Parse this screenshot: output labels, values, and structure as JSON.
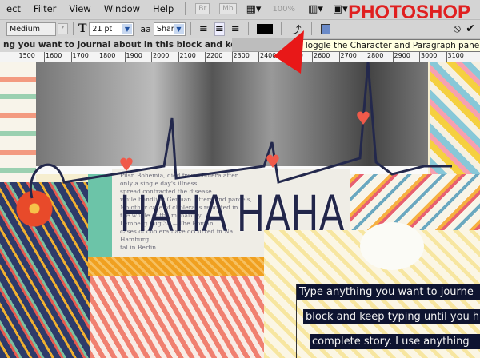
{
  "menu": [
    "ect",
    "Filter",
    "View",
    "Window",
    "Help"
  ],
  "menu_mini": [
    "Br",
    "Mb"
  ],
  "zoom_level": "100%",
  "brand": "PHOTOSHOP",
  "options": {
    "antialias_weight": "Medium",
    "font_size": "21 pt",
    "aa_label": "a",
    "aa_sub": "a",
    "antialias": "Sharp"
  },
  "document_tab": "ng you want to journal about in this block and keep , RGB/8) *",
  "tooltip": "Toggle the Character and Paragraph panels",
  "ruler": [
    "00",
    "1500",
    "1600",
    "1700",
    "1800",
    "1900",
    "2000",
    "2100",
    "2200",
    "2300",
    "2400",
    "2500",
    "2600",
    "2700",
    "2800",
    "2900",
    "3000",
    "3100"
  ],
  "canvas": {
    "title_text": "HAHA HAHA",
    "news": [
      "Pilsn Bohemia, died from cholera after",
      "only a single day's illness.",
      "spread contracted the disease",
      "while handling German letters and parcels,",
      "No other case of cholera is reported in",
      "the whole of the monarchy.",
      "Lemberg Aug 30.—The Roman",
      "cases of cholera have occurred in Na",
      "Hamburg.",
      "tal in Berlin."
    ],
    "journal": [
      "Type anything you want to journe",
      "block and keep typing until you h",
      "complete story. I use anything"
    ]
  },
  "colors": {
    "accent": "#e02020",
    "navy": "#1f2448",
    "orange": "#f0a020",
    "coral": "#f06050"
  }
}
